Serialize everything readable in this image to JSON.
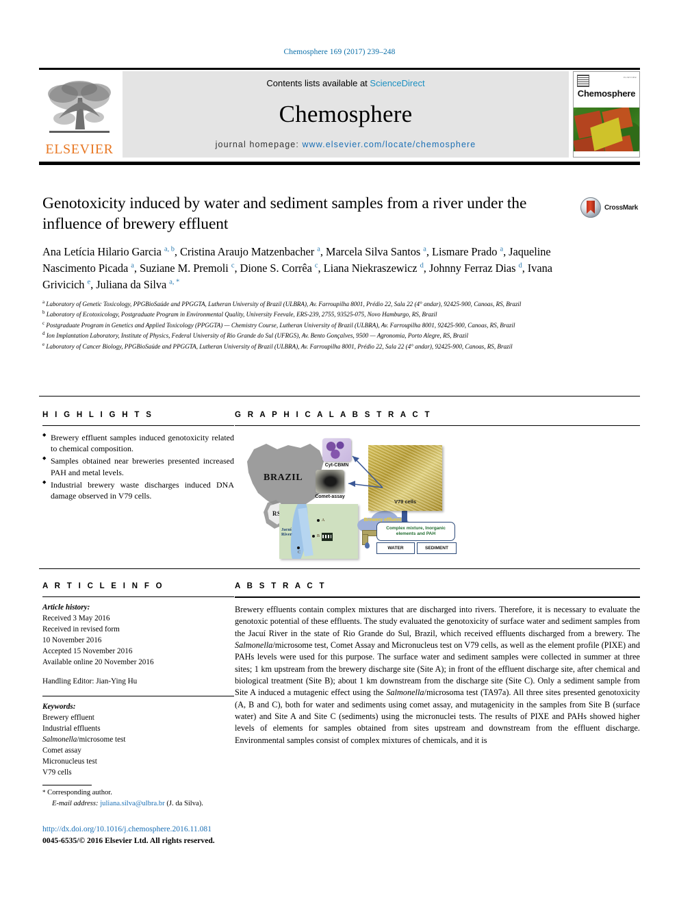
{
  "top_citation": "Chemosphere 169 (2017) 239–248",
  "header": {
    "contents_prefix": "Contents lists available at ",
    "sciencedirect": "ScienceDirect",
    "journal_title": "Chemosphere",
    "homepage_label": "journal homepage: ",
    "homepage_url": "www.elsevier.com/locate/chemosphere",
    "publisher": "ELSEVIER",
    "cover_title": "Chemosphere"
  },
  "article": {
    "title": "Genotoxicity induced by water and sediment samples from a river under the influence of brewery effluent",
    "crossmark_label": "CrossMark",
    "authors_html": "Ana Letícia Hilario Garcia <sup>a, b</sup>, Cristina Araujo Matzenbacher <sup>a</sup>, Marcela Silva Santos <sup>a</sup>, Lismare Prado <sup>a</sup>, Jaqueline Nascimento Picada <sup>a</sup>, Suziane M. Premoli <sup>c</sup>, Dione S. Corrêa <sup>c</sup>, Liana Niekraszewicz <sup>d</sup>, Johnny Ferraz Dias <sup>d</sup>, Ivana Grivicich <sup>e</sup>, Juliana da Silva <sup>a, *</sup>",
    "affiliations": [
      "<sup>a</sup> Laboratory of Genetic Toxicology, PPGBioSaúde and PPGGTA, Lutheran University of Brazil (ULBRA), Av. Farroupilha 8001, Prédio 22, Sala 22 (4° andar), 92425-900, Canoas, RS, Brazil",
      "<sup>b</sup> Laboratory of Ecotoxicology, Postgraduate Program in Environmental Quality, University Feevale, ERS-239, 2755, 93525-075, Novo Hamburgo, RS, Brazil",
      "<sup>c</sup> Postgraduate Program in Genetics and Applied Toxicology (PPGGTA) — Chemistry Course, Lutheran University of Brazil (ULBRA), Av. Farroupilha 8001, 92425-900, Canoas, RS, Brazil",
      "<sup>d</sup> Ion Implantation Laboratory, Institute of Physics, Federal University of Rio Grande do Sul (UFRGS), Av. Bento Gonçalves, 9500 — Agronomia, Porto Alegre, RS, Brazil",
      "<sup>e</sup> Laboratory of Cancer Biology, PPGBioSaúde and PPGGTA, Lutheran University of Brazil (ULBRA), Av. Farroupilha 8001, Prédio 22, Sala 22 (4° andar), 92425-900, Canoas, RS, Brazil"
    ]
  },
  "highlights": {
    "heading": "H I G H L I G H T S",
    "items": [
      "Brewery effluent samples induced genotoxicity related to chemical composition.",
      "Samples obtained near breweries presented increased PAH and metal levels.",
      "Industrial brewery waste discharges induced DNA damage observed in V79 cells."
    ]
  },
  "graphical_abstract": {
    "heading": "G R A P H I C A L   A B S T R A C T",
    "labels": {
      "brazil": "BRAZIL",
      "state": "RS",
      "river": "Jacuí\nRiver",
      "site_a": "A",
      "site_b": "B",
      "site_c": "C",
      "cloud": "Brewery effluent",
      "mixture_box": "Complex mixture, Inorganic elements and PAH",
      "water_box": "WATER",
      "sediment_box": "SEDIMENT",
      "cell_panel": "V79 cells",
      "micronucleus": "Cyt-CBMN",
      "comet": "Comet-assay"
    }
  },
  "article_info": {
    "heading": "A R T I C L E   I N F O",
    "history_label": "Article history:",
    "history": [
      "Received 3 May 2016",
      "Received in revised form",
      "10 November 2016",
      "Accepted 15 November 2016",
      "Available online 20 November 2016"
    ],
    "handling_editor": "Handling Editor: Jian-Ying Hu",
    "keywords_label": "Keywords:",
    "keywords_html": [
      "Brewery effluent",
      "Industrial effluents",
      "<i>Salmonella</i>/microsome test",
      "Comet assay",
      "Micronucleus test",
      "V79 cells"
    ]
  },
  "abstract": {
    "heading": "A B S T R A C T",
    "text_html": "Brewery effluents contain complex mixtures that are discharged into rivers. Therefore, it is necessary to evaluate the genotoxic potential of these effluents. The study evaluated the genotoxicity of surface water and sediment samples from the Jacuí River in the state of Rio Grande do Sul, Brazil, which received effluents discharged from a brewery. The <i>Salmonella</i>/microsome test, Comet Assay and Micronucleus test on V79 cells, as well as the element profile (PIXE) and PAHs levels were used for this purpose. The surface water and sediment samples were collected in summer at three sites; 1 km upstream from the brewery discharge site (Site A); in front of the effluent discharge site, after chemical and biological treatment (Site B); about 1 km downstream from the discharge site (Site C). Only a sediment sample from Site A induced a mutagenic effect using the <i>Salmonella</i>/microsoma test (TA97a). All three sites presented genotoxicity (A, B and C), both for water and sediments using comet assay, and mutagenicity in the samples from Site B (surface water) and Site A and Site C (sediments) using the micronuclei tests. The results of PIXE and PAHs showed higher levels of elements for samples obtained from sites upstream and downstream from the effluent discharge. Environmental samples consist of complex mixtures of chemicals, and it is"
  },
  "footer": {
    "corresponding_marker": "*",
    "corresponding_label": "Corresponding author.",
    "email_label": "E-mail address:",
    "email": "juliana.silva@ulbra.br",
    "email_owner": "(J. da Silva).",
    "doi": "http://dx.doi.org/10.1016/j.chemosphere.2016.11.081",
    "copyright": "0045-6535/© 2016 Elsevier Ltd. All rights reserved."
  }
}
